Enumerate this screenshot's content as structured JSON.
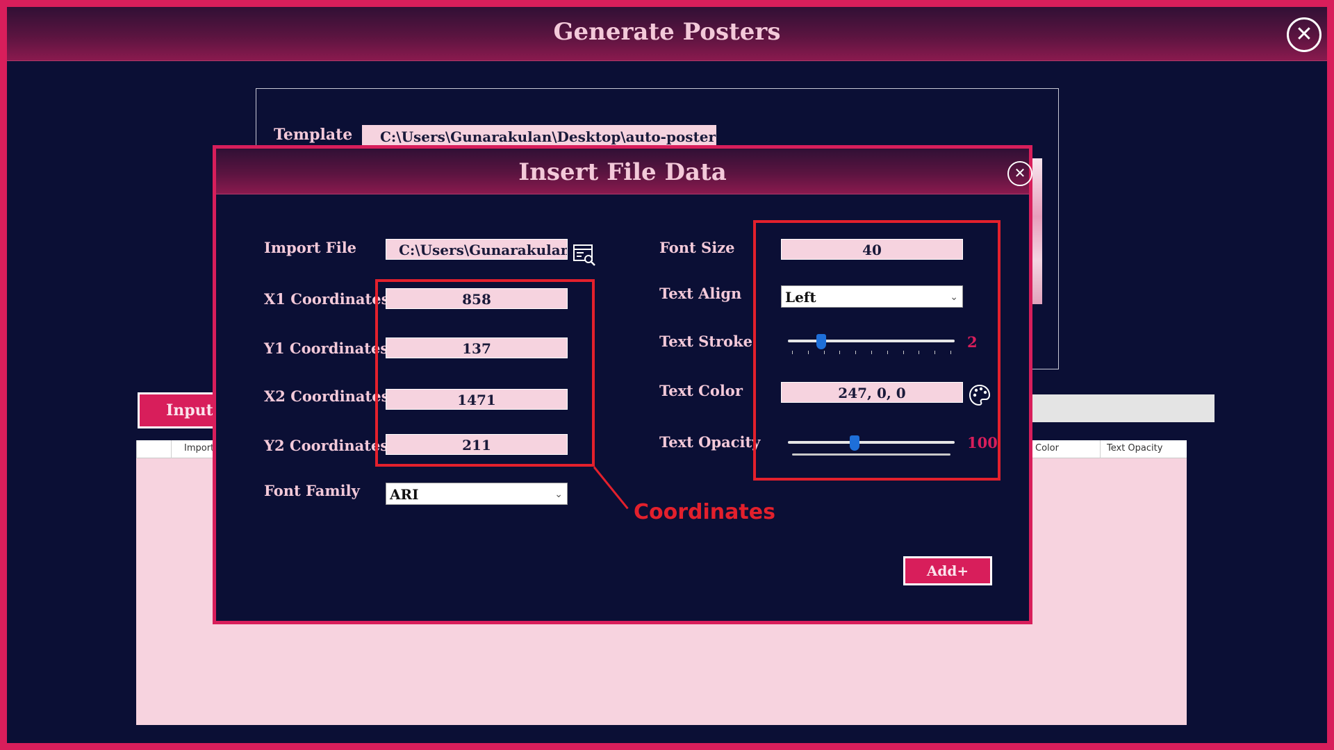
{
  "window": {
    "title": "Generate Posters",
    "close_icon": "close-circle-icon"
  },
  "template": {
    "label": "Template",
    "path": "C:\\Users\\Gunarakulan\\Desktop\\auto-poster-"
  },
  "tabs": {
    "input_label": "Input F"
  },
  "table": {
    "columns": [
      "Import Fi",
      "Color",
      "Text Opacity"
    ]
  },
  "dialog": {
    "title": "Insert File Data",
    "close_icon": "close-circle-icon",
    "import_file": {
      "label": "Import File",
      "value": "C:\\Users\\Gunarakulan",
      "icon": "browse-file-icon"
    },
    "x1": {
      "label": "X1 Coordinates",
      "value": "858"
    },
    "y1": {
      "label": "Y1 Coordinates",
      "value": "137"
    },
    "x2": {
      "label": "X2 Coordinates",
      "value": "1471"
    },
    "y2": {
      "label": "Y2 Coordinates",
      "value": "211"
    },
    "font_family": {
      "label": "Font Family",
      "value": "ARI"
    },
    "font_size": {
      "label": "Font Size",
      "value": "40"
    },
    "text_align": {
      "label": "Text Align",
      "value": "Left"
    },
    "text_stroke": {
      "label": "Text Stroke",
      "value": "2",
      "level_fraction": 0.2
    },
    "text_color": {
      "label": "Text Color",
      "value": "247, 0, 0",
      "icon": "color-palette-icon"
    },
    "text_opacity": {
      "label": "Text Opacity",
      "value": "100",
      "level_fraction": 0.4
    },
    "add_button": "Add+"
  },
  "annotation": {
    "callout": "Coordinates",
    "color": "#e3202c"
  },
  "colors": {
    "accent": "#d81e5b",
    "background": "#0b0f35",
    "field": "#f6d3df"
  }
}
